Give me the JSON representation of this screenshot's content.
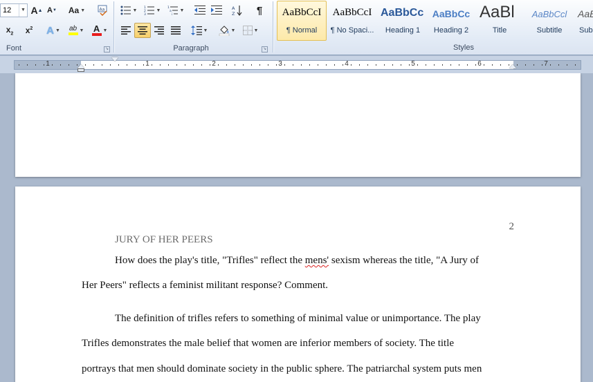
{
  "ribbon": {
    "font_group": {
      "label": "Font",
      "font_size": "12",
      "grow_font": "A",
      "shrink_font": "A",
      "change_case": "Aa",
      "subscript": "x",
      "subscript_sub": "2",
      "superscript": "x",
      "superscript_sup": "2",
      "text_effects": "A",
      "highlight": "ab",
      "font_color": "A"
    },
    "paragraph_group": {
      "label": "Paragraph",
      "show_marks": "¶"
    },
    "styles_group": {
      "label": "Styles",
      "items": [
        {
          "preview": "AaBbCcI",
          "name": "¶ Normal",
          "selected": true
        },
        {
          "preview": "AaBbCcI",
          "name": "¶ No Spaci...",
          "selected": false
        },
        {
          "preview": "AaBbCc",
          "name": "Heading 1",
          "selected": false
        },
        {
          "preview": "AaBbCc",
          "name": "Heading 2",
          "selected": false
        },
        {
          "preview": "AaBl",
          "name": "Title",
          "selected": false
        },
        {
          "preview": "AaBbCcl",
          "name": "Subtitle",
          "selected": false
        },
        {
          "preview": "AaBl",
          "name": "Sub",
          "selected": false
        }
      ]
    }
  },
  "ruler": {
    "numbers": [
      "1",
      "1",
      "2",
      "3",
      "4",
      "5",
      "6",
      "7"
    ]
  },
  "document": {
    "page_number": "2",
    "heading": "JURY OF HER PEERS",
    "paragraph1": {
      "line1_before": "How does the play's title, \"Trifles\" reflect the ",
      "line1_misspelled": "mens'",
      "line1_after": " sexism  whereas the title, \"A Jury of",
      "line2": "Her Peers\" reflects a feminist militant response? Comment."
    },
    "paragraph2": {
      "line1": "The definition of trifles refers to something of minimal  value or unimportance. The play",
      "line2": "Trifles  demonstrates the male belief that women are inferior members  of society. The title",
      "line3": "portrays that men should dominate society in the public sphere. The patriarchal  system puts men"
    }
  },
  "colors": {
    "ribbon_text": "#1e395b",
    "doc_background": "#abb9cd",
    "heading_color": "#6b6b6b",
    "selected_style": "#fde9a9"
  }
}
